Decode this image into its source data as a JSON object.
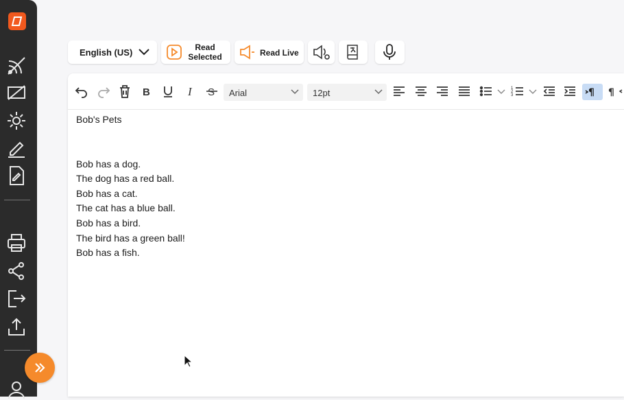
{
  "toolbar": {
    "language": "English (US)",
    "read_selected": "Read Selected",
    "read_live": "Read Live"
  },
  "editor_toolbar": {
    "font": "Arial",
    "size": "12pt"
  },
  "document": {
    "title": "Bob's Pets",
    "lines": [
      "Bob has a dog.",
      "The dog has a red ball.",
      "Bob has a cat.",
      "The cat has a blue ball.",
      "Bob has a bird.",
      "The bird has a green ball!",
      "Bob has a fish."
    ]
  },
  "colors": {
    "accent": "#f58a2b",
    "brand": "#f2591e",
    "sidebar": "#2b2b2b",
    "active_button": "#c8dcf5"
  }
}
